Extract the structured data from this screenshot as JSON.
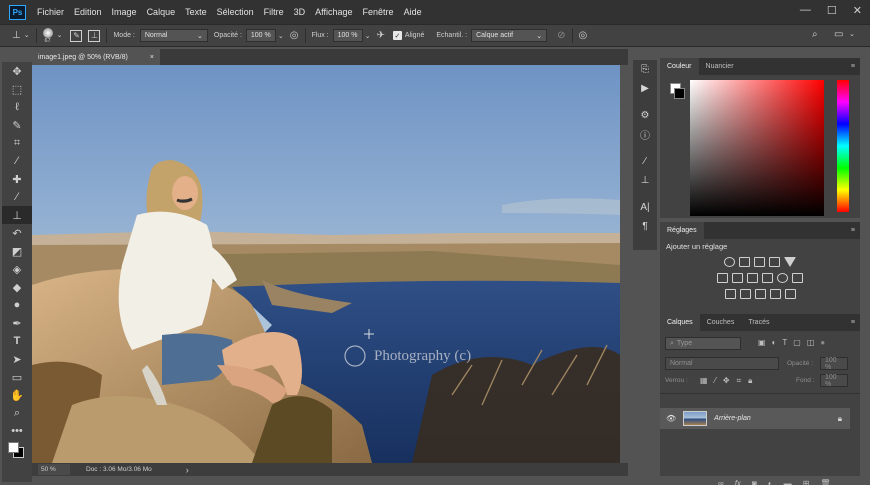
{
  "app": {
    "logo": "Ps"
  },
  "menu": [
    "Fichier",
    "Edition",
    "Image",
    "Calque",
    "Texte",
    "Sélection",
    "Filtre",
    "3D",
    "Affichage",
    "Fenêtre",
    "Aide"
  ],
  "window_controls": [
    "—",
    "☐",
    "✕"
  ],
  "options": {
    "brush_size": "67",
    "mode_label": "Mode :",
    "mode_value": "Normal",
    "opacity_label": "Opacité :",
    "opacity_value": "100 %",
    "flow_label": "Flux :",
    "flow_value": "100 %",
    "aligned_label": "Aligné",
    "sample_label": "Echantil. :",
    "sample_value": "Calque actif"
  },
  "document": {
    "tab_title": "image1.jpeg @ 50% (RVB/8)",
    "tab_close": "×",
    "watermark": "Photography (c)"
  },
  "status": {
    "zoom": "50 %",
    "doc": "Doc : 3.06 Mo/3.06 Mo",
    "arrow": "›"
  },
  "color_panel": {
    "tabs": [
      "Couleur",
      "Nuancier"
    ]
  },
  "adjust_panel": {
    "tab": "Réglages",
    "title": "Ajouter un réglage"
  },
  "layers_panel": {
    "tabs": [
      "Calques",
      "Couches",
      "Tracés"
    ],
    "filter_placeholder": "Type",
    "blend_mode": "Normal",
    "opacity_label": "Opacité :",
    "opacity_value": "100 %",
    "lock_label": "Verrou :",
    "fill_label": "Fond :",
    "fill_value": "100 %",
    "layer_name": "Arrière-plan"
  },
  "colors": {
    "accent": "#31a8ff",
    "ui_dark": "#323232",
    "ui_mid": "#424242",
    "ui_canvas": "#535353"
  }
}
